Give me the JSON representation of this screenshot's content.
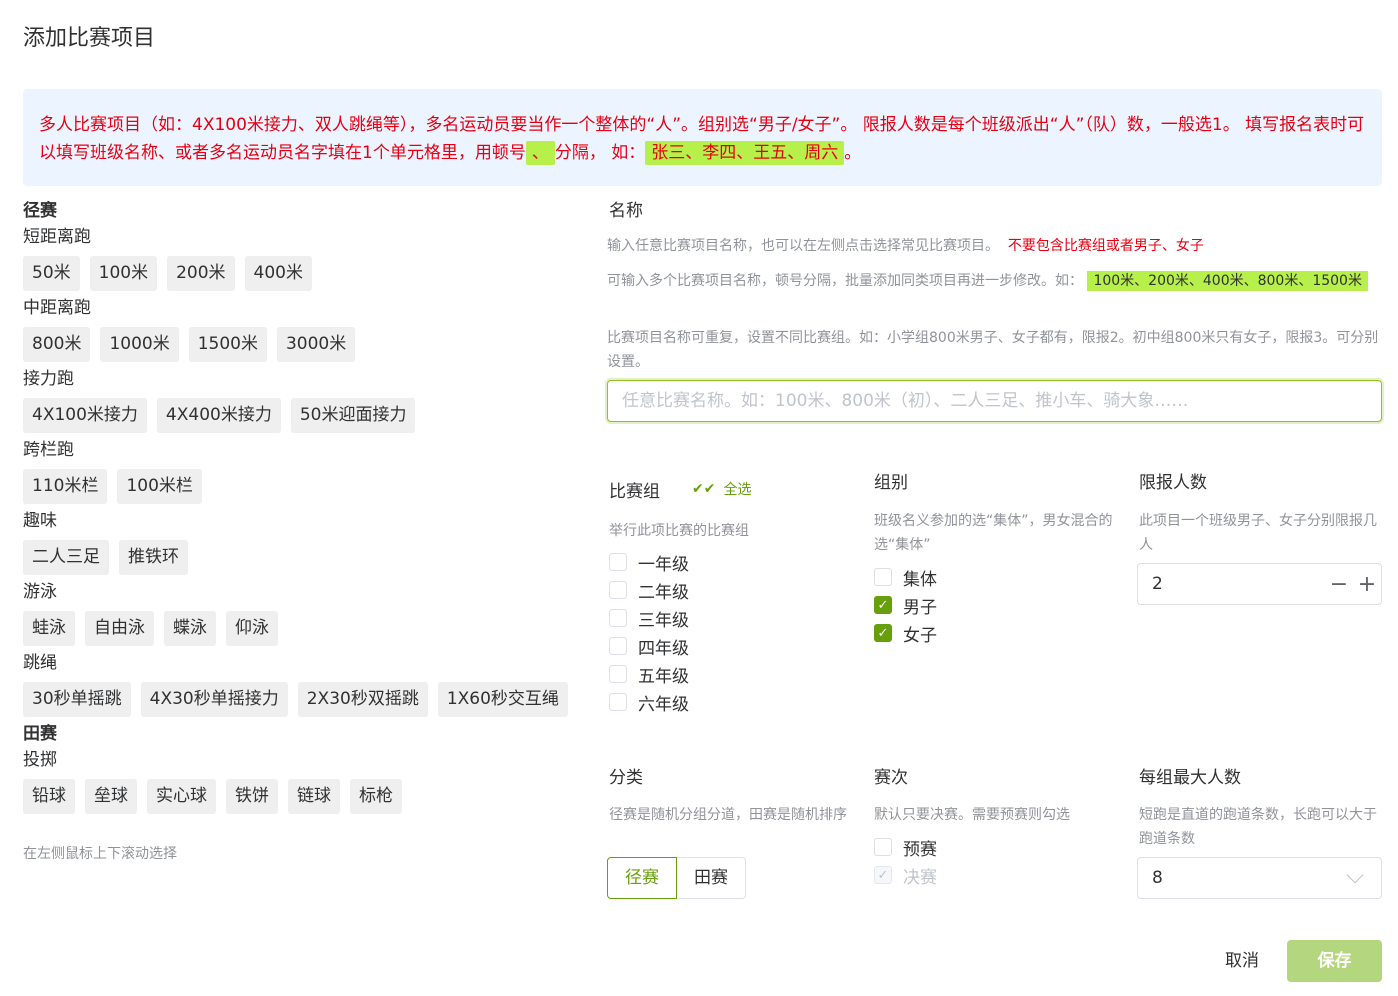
{
  "dialog": {
    "title": "添加比赛项目"
  },
  "notice": {
    "text1": "多人比赛项目（如：4X100米接力、双人跳绳等），多名运动员要当作一个整体的“人”。组别选“男子/女子”。 限报人数是每个班级派出“人”（队）数，一般选1。 填写报名表时可以填写班级名称、或者多名运动员名字填在1个单元格里，用顿号",
    "separator": "、",
    "text2": "分隔，  如：",
    "example": "张三、李四、王五、周六",
    "text3": "。"
  },
  "events": {
    "track_title": "径赛",
    "sprint_title": "短距离跑",
    "sprint": [
      "50米",
      "100米",
      "200米",
      "400米"
    ],
    "middle_title": "中距离跑",
    "middle": [
      "800米",
      "1000米",
      "1500米",
      "3000米"
    ],
    "relay_title": "接力跑",
    "relay": [
      "4X100米接力",
      "4X400米接力",
      "50米迎面接力"
    ],
    "hurdle_title": "跨栏跑",
    "hurdle": [
      "110米栏",
      "100米栏"
    ],
    "fun_title": "趣味",
    "fun": [
      "二人三足",
      "推铁环"
    ],
    "swim_title": "游泳",
    "swim": [
      "蛙泳",
      "自由泳",
      "蝶泳",
      "仰泳"
    ],
    "rope_title": "跳绳",
    "rope": [
      "30秒单摇跳",
      "4X30秒单摇接力",
      "2X30秒双摇跳",
      "1X60秒交互绳"
    ],
    "field_title": "田赛",
    "throw_title": "投掷",
    "throw": [
      "铅球",
      "垒球",
      "实心球",
      "铁饼",
      "链球",
      "标枪"
    ],
    "scroll_hint": "在左侧鼠标上下滚动选择"
  },
  "name": {
    "label": "名称",
    "hint1": "输入任意比赛项目名称，也可以在左侧点击选择常见比赛项目。",
    "hint1_red": "不要包含比赛组或者男子、女子",
    "hint2": "可输入多个比赛项目名称，顿号分隔，批量添加同类项目再进一步修改。如：",
    "hint2_example": "100米、200米、400米、800米、1500米",
    "hint3": "比赛项目名称可重复，设置不同比赛组。如：小学组800米男子、女子都有，限报2。初中组800米只有女子，限报3。可分别设置。",
    "placeholder": "任意比赛名称。如：100米、800米（初）、二人三足、推小车、骑大象……"
  },
  "groups": {
    "label": "比赛组",
    "select_all": "全选",
    "hint": "举行此项比赛的比赛组",
    "items": [
      "一年级",
      "二年级",
      "三年级",
      "四年级",
      "五年级",
      "六年级"
    ]
  },
  "division": {
    "label": "组别",
    "hint": "班级名义参加的选“集体”，男女混合的选“集体”",
    "items": [
      "集体",
      "男子",
      "女子"
    ]
  },
  "limit": {
    "label": "限报人数",
    "hint": "此项目一个班级男子、女子分别限报几人",
    "value": "2",
    "minus": "−",
    "plus": "+"
  },
  "category": {
    "label": "分类",
    "hint": "径赛是随机分组分道，田赛是随机排序",
    "options": [
      "径赛",
      "田赛"
    ]
  },
  "rounds": {
    "label": "赛次",
    "hint": "默认只要决赛。需要预赛则勾选",
    "items": [
      "预赛",
      "决赛"
    ]
  },
  "max_per_group": {
    "label": "每组最大人数",
    "hint": "短跑是直道的跑道条数，长跑可以大于跑道条数",
    "value": "8"
  },
  "footer": {
    "cancel": "取消",
    "save": "保存"
  },
  "colors": {
    "accent": "#67a00a",
    "highlight": "#b7f04a",
    "warning": "#e60012",
    "notice_bg": "#ecf5ff"
  }
}
